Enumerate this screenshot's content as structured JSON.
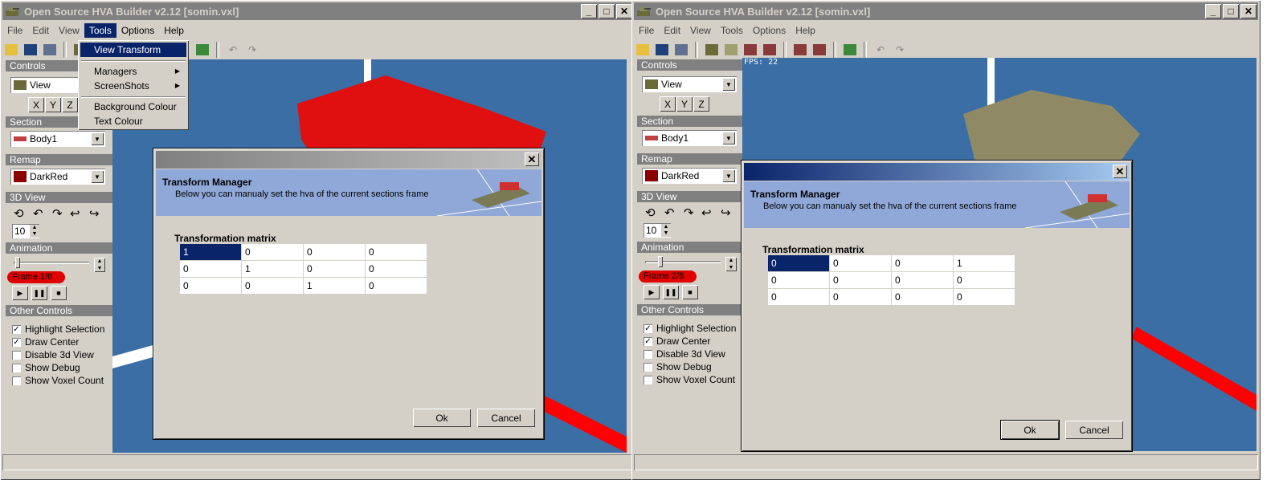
{
  "colors": {
    "viewport_bg": "#3a6ea5",
    "highlight": "#0a246a",
    "banner_bg": "#8fa8d8",
    "remap": "#8b0000"
  },
  "windows": [
    {
      "title": "Open Source HVA Builder v2.12 [somin.vxl]",
      "menu": [
        "File",
        "Edit",
        "View",
        "Tools",
        "Options",
        "Help"
      ],
      "tools_menu": {
        "items": [
          {
            "label": "View Transform"
          },
          {
            "label": "Managers"
          },
          {
            "label": "ScreenShots"
          },
          {
            "label": "Background Colour"
          },
          {
            "label": "Text Colour"
          }
        ]
      },
      "sidebar": {
        "controls_header": "Controls",
        "view_value": "View",
        "axes": [
          "X",
          "Y",
          "Z"
        ],
        "section_header": "Section",
        "section_value": "Body1",
        "remap_header": "Remap",
        "remap_value": "DarkRed",
        "view3d_header": "3D View",
        "spin_value": "10",
        "animation_header": "Animation",
        "frame_label": "Frame 1/6",
        "other_header": "Other Controls",
        "checks": [
          {
            "label": "Highlight Selection",
            "checked": "✓"
          },
          {
            "label": "Draw Center",
            "checked": "✓"
          },
          {
            "label": "Disable 3d View",
            "checked": ""
          },
          {
            "label": "Show Debug",
            "checked": ""
          },
          {
            "label": "Show Voxel Count",
            "checked": ""
          }
        ]
      },
      "dialog": {
        "heading": "Transform Manager",
        "description": "Below you can manualy set the hva of the current sections frame",
        "matrix_label": "Transformation matrix",
        "matrix": [
          [
            "1",
            "0",
            "0",
            "0"
          ],
          [
            "0",
            "1",
            "0",
            "0"
          ],
          [
            "0",
            "0",
            "1",
            "0"
          ]
        ],
        "ok_label": "Ok",
        "cancel_label": "Cancel"
      }
    },
    {
      "title": "Open Source HVA Builder v2.12 [somin.vxl]",
      "menu": [
        "File",
        "Edit",
        "View",
        "Tools",
        "Options",
        "Help"
      ],
      "fps": "FPS: 22",
      "sidebar": {
        "controls_header": "Controls",
        "view_value": "View",
        "axes": [
          "X",
          "Y",
          "Z"
        ],
        "section_header": "Section",
        "section_value": "Body1",
        "remap_header": "Remap",
        "remap_value": "DarkRed",
        "view3d_header": "3D View",
        "spin_value": "10",
        "animation_header": "Animation",
        "frame_label": "Frame 2/6",
        "other_header": "Other Controls",
        "checks": [
          {
            "label": "Highlight Selection",
            "checked": "✓"
          },
          {
            "label": "Draw Center",
            "checked": "✓"
          },
          {
            "label": "Disable 3d View",
            "checked": ""
          },
          {
            "label": "Show Debug",
            "checked": ""
          },
          {
            "label": "Show Voxel Count",
            "checked": ""
          }
        ]
      },
      "dialog": {
        "heading": "Transform Manager",
        "description": "Below you can manualy set the hva of the current sections frame",
        "matrix_label": "Transformation matrix",
        "matrix": [
          [
            "0",
            "0",
            "0",
            "1"
          ],
          [
            "0",
            "0",
            "0",
            "0"
          ],
          [
            "0",
            "0",
            "0",
            "0"
          ]
        ],
        "ok_label": "Ok",
        "cancel_label": "Cancel"
      }
    }
  ]
}
